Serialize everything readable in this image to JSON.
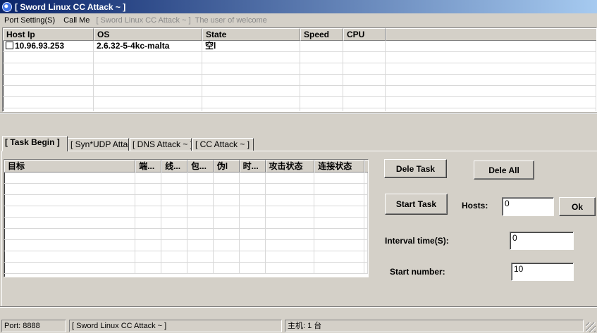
{
  "window": {
    "title": "[ Sword Linux  CC Attack ~ ]"
  },
  "menu": {
    "items": [
      "Port Setting(S)",
      "Call Me"
    ],
    "caption_1": "[ Sword Linux CC Attack ~ ]",
    "caption_2": "The user of welcome"
  },
  "hosts": {
    "columns": [
      "Host Ip",
      "OS",
      "State",
      "Speed",
      "CPU"
    ],
    "rows": [
      {
        "ip": "10.96.93.253",
        "os": "2.6.32-5-4kc-malta",
        "state": "空l",
        "speed": "",
        "cpu": ""
      }
    ]
  },
  "tabs": [
    "[ Task Begin ]",
    "[ Syn*UDP Attack ~ ]",
    "[ DNS Attack ~ ]",
    "[ CC  Attack ~ ]"
  ],
  "tasks": {
    "columns": [
      "目标",
      "端...",
      "线...",
      "包...",
      "伪l",
      "时...",
      "攻击状态",
      "连接状态"
    ]
  },
  "controls": {
    "dele_task": "Dele Task",
    "dele_all": "Dele All",
    "start_task": "Start Task",
    "hosts_label": "Hosts:",
    "hosts_value": "0",
    "ok": "Ok",
    "interval_label": "Interval time(S):",
    "interval_value": "0",
    "start_number_label": "Start number:",
    "start_number_value": "10"
  },
  "status": {
    "port": "Port: 8888",
    "caption": "[ Sword Linux CC Attack ~ ]",
    "hosts": "主机: 1 台"
  }
}
